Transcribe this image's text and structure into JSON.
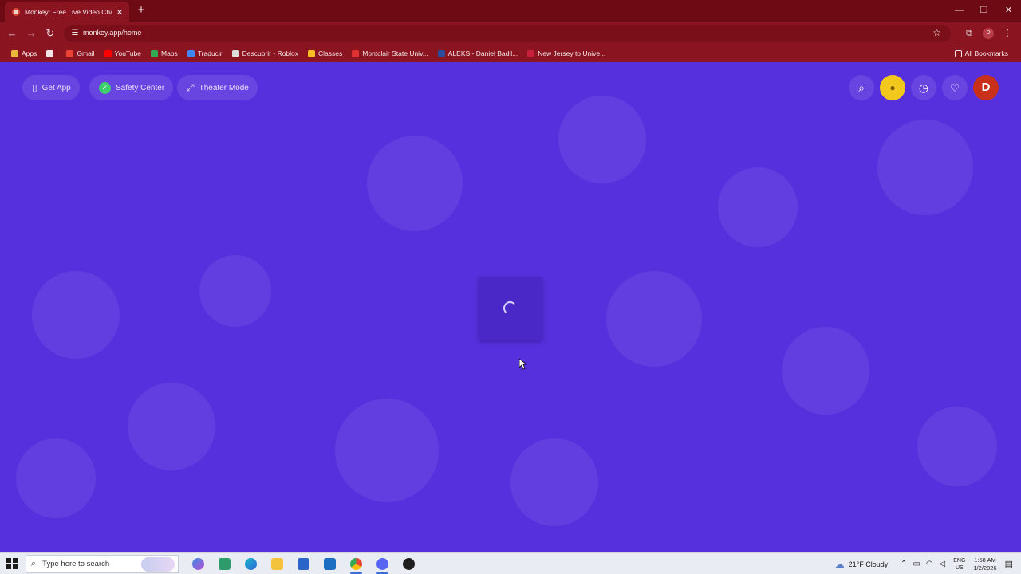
{
  "browser": {
    "tab_title": "Monkey: Free Live Video Chat",
    "url": "monkey.app/home"
  },
  "bookmarks": [
    {
      "label": "Apps",
      "icon": "apps-grid-icon",
      "color": "#e8b93b"
    },
    {
      "label": "",
      "icon": "grid-icon",
      "color": "#f4e6e8"
    },
    {
      "label": "Gmail",
      "icon": "gmail-icon",
      "color": "#ea4335"
    },
    {
      "label": "YouTube",
      "icon": "youtube-icon",
      "color": "#ff0000"
    },
    {
      "label": "Maps",
      "icon": "maps-icon",
      "color": "#34a853"
    },
    {
      "label": "Traducir",
      "icon": "translate-icon",
      "color": "#4285f4"
    },
    {
      "label": "Descubrir - Roblox",
      "icon": "roblox-icon",
      "color": "#dddddd"
    },
    {
      "label": "Classes",
      "icon": "classroom-icon",
      "color": "#f6c026"
    },
    {
      "label": "Montclair State Univ...",
      "icon": "montclair-icon",
      "color": "#e03030"
    },
    {
      "label": "ALEKS - Daniel Badil...",
      "icon": "aleks-icon",
      "color": "#2a4c9a"
    },
    {
      "label": "New Jersey to Unive...",
      "icon": "nj-icon",
      "color": "#c81f3c"
    }
  ],
  "all_bookmarks_label": "All Bookmarks",
  "page": {
    "pills": {
      "get_app": "Get App",
      "safety_center": "Safety Center",
      "theater_mode": "Theater Mode"
    },
    "avatar_initial": "D"
  },
  "taskbar": {
    "search_placeholder": "Type here to search",
    "weather": "21°F  Cloudy",
    "lang_top": "ENG",
    "lang_bottom": "US",
    "time": "1:58 AM",
    "date": "1/2/2026"
  },
  "colors": {
    "page_bg": "#5730dd",
    "browser_chrome": "#8a1420",
    "coin": "#f2c81d",
    "avatar": "#c8301a"
  }
}
